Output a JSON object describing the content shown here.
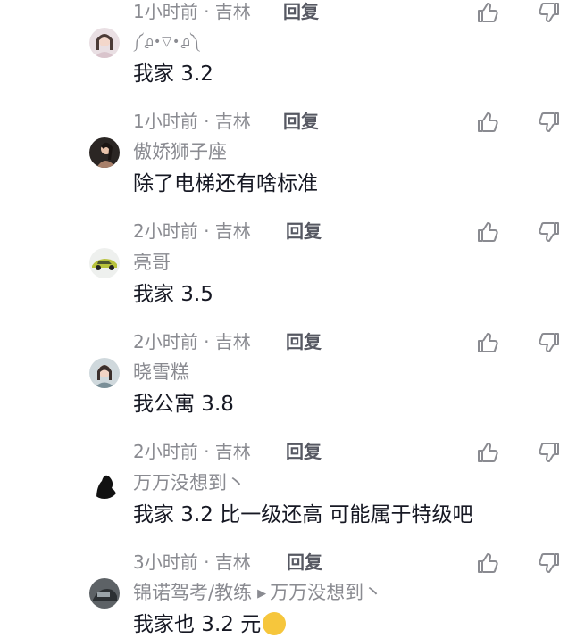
{
  "top_partial": {
    "meta": "1小时前 · 吉林",
    "reply_label": "回复"
  },
  "comments": [
    {
      "username": "༼൧•▽•൧༽",
      "text": "我家 3.2",
      "meta": "1小时前 · 吉林",
      "reply_label": "回复"
    },
    {
      "username": "傲娇狮子座",
      "text": "除了电梯还有啥标准",
      "meta": "2小时前 · 吉林",
      "reply_label": "回复"
    },
    {
      "username": "亮哥",
      "text": "我家 3.5",
      "meta": "2小时前 · 吉林",
      "reply_label": "回复"
    },
    {
      "username": "晓雪糕",
      "text": "我公寓 3.8",
      "meta": "2小时前 · 吉林",
      "reply_label": "回复"
    },
    {
      "username": "万万没想到丶",
      "text": "我家 3.2 比一级还高 可能属于特级吧",
      "meta": "3小时前 · 吉林",
      "reply_label": "回复"
    },
    {
      "username": "锦诺驾考/教练",
      "reply_to": "万万没想到丶",
      "text": "我家也 3.2 元"
    }
  ],
  "icons": {
    "like": "thumbs-up-icon",
    "dislike": "thumbs-down-icon",
    "reply_arrow": "play-triangle-icon"
  }
}
